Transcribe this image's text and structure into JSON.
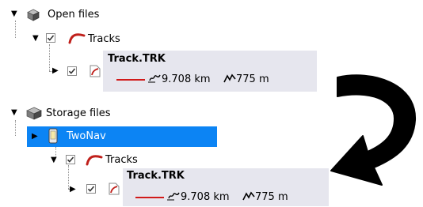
{
  "tree": {
    "open_files": {
      "label": "Open files",
      "tracks_label": "Tracks",
      "track": {
        "name": "Track.TRK",
        "distance": "9.708 km",
        "elevation": "775 m"
      }
    },
    "storage_files": {
      "label": "Storage files",
      "device_label": "TwoNav",
      "tracks_label": "Tracks",
      "track": {
        "name": "Track.TRK",
        "distance": "9.708 km",
        "elevation": "775 m"
      }
    }
  },
  "colors": {
    "selection": "#0c84f4",
    "track_line": "#d11a1a",
    "panel": "#e6e6ee",
    "arrow": "#000000"
  },
  "icons": [
    "expand-triangle-icon",
    "collapse-triangle-icon",
    "cube-icon",
    "checkbox-icon",
    "track-curve-icon",
    "track-file-icon",
    "device-icon",
    "distance-icon",
    "elevation-icon",
    "curved-arrow-icon"
  ]
}
